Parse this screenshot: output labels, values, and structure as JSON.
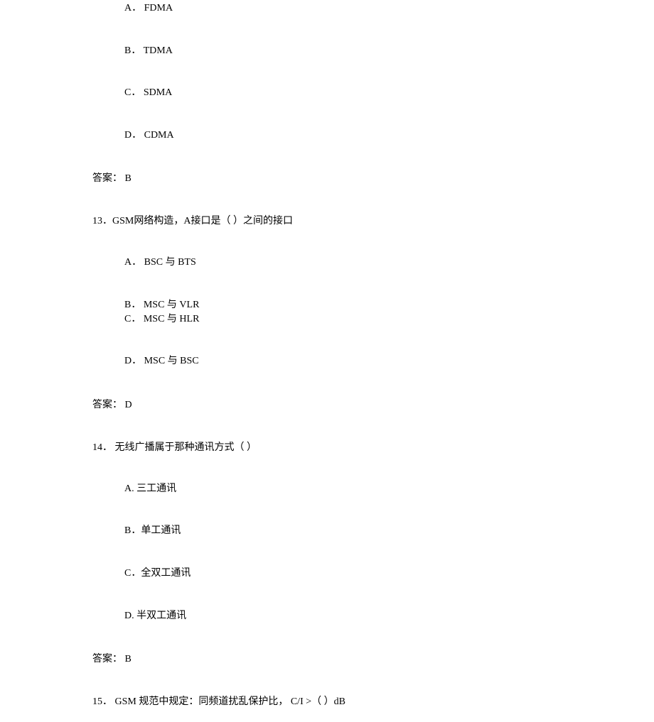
{
  "q12": {
    "optA": "A．  FDMA",
    "optB": "B．  TDMA",
    "optC": "C．  SDMA",
    "optD": "D．  CDMA",
    "answer": "答案：  B"
  },
  "q13": {
    "text": "13．GSM网络构造，A接口是（              ）之间的接口",
    "optA": "A．  BSC 与 BTS",
    "optB": "B． MSC 与 VLR",
    "optC": "C．  MSC 与 HLR",
    "optD": "D．  MSC 与 BSC",
    "answer": "答案：  D"
  },
  "q14": {
    "text": "14． 无线广播属于那种通讯方式（              ）",
    "optA": "A. 三工通讯",
    "optB": "B．单工通讯",
    "optC": "C．全双工通讯",
    "optD": "D. 半双工通讯",
    "answer": "答案：  B"
  },
  "q15": {
    "text": "15．  GSM 规范中规定：同频道扰乱保护比，  C/I >（                 ）dB"
  }
}
